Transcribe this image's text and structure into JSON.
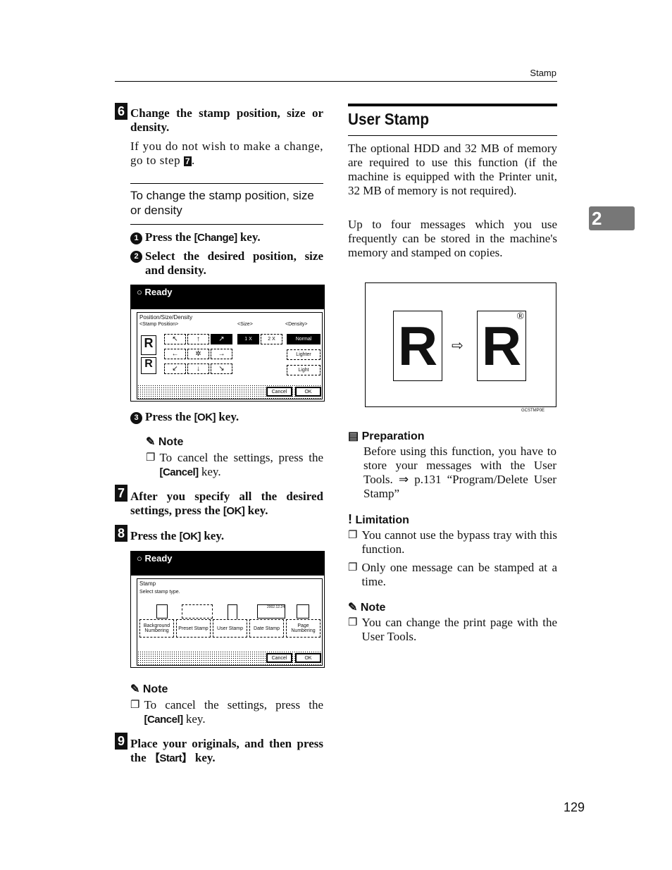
{
  "header": {
    "section": "Stamp"
  },
  "chapter_tab": "2",
  "page_number": "129",
  "left": {
    "step6": {
      "num": "6",
      "title": "Change the stamp position, size or density.",
      "text_a": "If you do not wish to make a change, go to step ",
      "step_ref": "7",
      "text_b": "."
    },
    "subhead": "To change the stamp position, size or density",
    "sub1": {
      "num": "1",
      "a": "Press the ",
      "key": "[Change]",
      "b": " key."
    },
    "sub2": {
      "num": "2",
      "text": "Select the desired position, size and density."
    },
    "screen1": {
      "status": "Ready",
      "title": "Position/Size/Density",
      "stamp_position": "<Stamp Position>",
      "size": "<Size>",
      "density": "<Density>",
      "arrows": [
        "↖",
        "↑",
        "↗",
        "←",
        "✲",
        "→",
        "↙",
        "↓",
        "↘"
      ],
      "sizes": [
        "1 X",
        "2 X"
      ],
      "densities": [
        "Normal",
        "Lighter",
        "Light"
      ],
      "cancel": "Cancel",
      "ok": "OK"
    },
    "sub3": {
      "num": "3",
      "a": "Press the ",
      "key": "[OK]",
      "b": " key."
    },
    "note1": {
      "title": "Note",
      "a": "To cancel the settings, press the ",
      "key": "[Cancel]",
      "b": " key."
    },
    "step7": {
      "num": "7",
      "a": "After you specify all the desired settings, press the ",
      "key": "[OK]",
      "b": " key."
    },
    "step8": {
      "num": "8",
      "a": "Press the ",
      "key": "[OK]",
      "b": " key."
    },
    "screen2": {
      "status": "Ready",
      "title": "Stamp",
      "prompt": "Select stamp type.",
      "types": [
        "Background Numbering",
        "Preset Stamp",
        "User Stamp",
        "Date Stamp",
        "Page Numbering"
      ],
      "date": "2002.12.24",
      "cancel": "Cancel",
      "ok": "OK"
    },
    "note2": {
      "title": "Note",
      "a": "To cancel the settings, press the ",
      "key": "[Cancel]",
      "b": " key."
    },
    "step9": {
      "num": "9",
      "a": "Place your originals, and then press the ",
      "key": "【Start】",
      "b": " key."
    }
  },
  "right": {
    "title": "User Stamp",
    "para1": "The optional HDD and 32 MB of memory are required to use this function (if the machine is equipped with the Printer unit, 32 MB of memory is not required).",
    "para2": "Up to four messages which you use frequently can be stored in the machine's memory and stamped on copies.",
    "figure": {
      "letter": "R",
      "mark": "®",
      "code": "GCSTMP0E"
    },
    "preparation": {
      "title": "Preparation",
      "text": "Before using this function, you have to store your messages with the User Tools. ⇒ p.131 “Program/Delete User Stamp”"
    },
    "limitation": {
      "title": "Limitation",
      "items": [
        "You cannot use the bypass tray with this function.",
        "Only one message can be stamped at a time."
      ]
    },
    "note": {
      "title": "Note",
      "items": [
        "You can change the print page with the User Tools."
      ]
    }
  }
}
